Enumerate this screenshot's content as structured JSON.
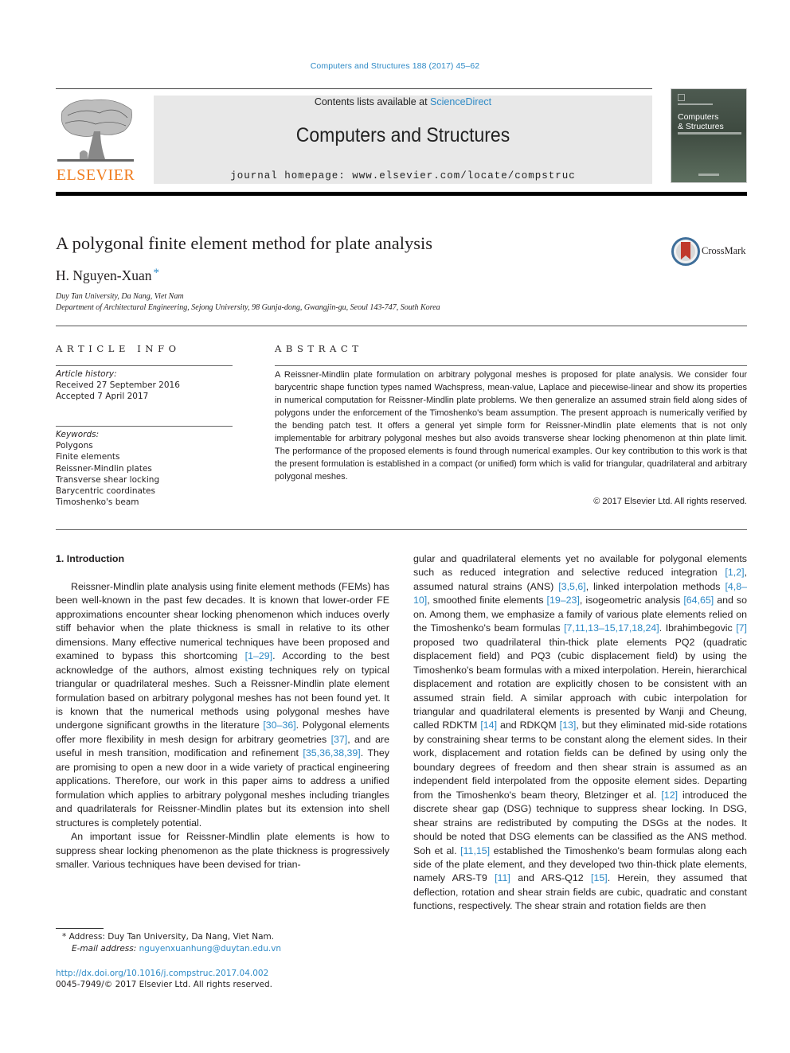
{
  "running_head": "Computers and Structures 188 (2017) 45–62",
  "masthead": {
    "publisher_logo_text": "ELSEVIER",
    "contents_prefix": "Contents lists available at ",
    "contents_link": "ScienceDirect",
    "journal_name": "Computers and Structures",
    "homepage": "journal homepage: www.elsevier.com/locate/compstruc",
    "cover_title_line1": "Computers",
    "cover_title_line2": "& Structures"
  },
  "colors": {
    "link": "#2e8ac6",
    "elsevier_orange": "#f07c1d",
    "masthead_gray": "#e8e8e8"
  },
  "article": {
    "title": "A polygonal finite element method for plate analysis",
    "crossmark_label": "CrossMark",
    "author": "H. Nguyen-Xuan",
    "author_mark": "*",
    "affiliations": [
      "Duy Tan University, Da Nang, Viet Nam",
      "Department of Architectural Engineering, Sejong University, 98 Gunja-dong, Gwangjin-gu, Seoul 143-747, South Korea"
    ]
  },
  "article_info": {
    "heading": "ARTICLE INFO",
    "history_label": "Article history:",
    "received": "Received 27 September 2016",
    "accepted": "Accepted 7 April 2017",
    "keywords_label": "Keywords:",
    "keywords": [
      "Polygons",
      "Finite elements",
      "Reissner-Mindlin plates",
      "Transverse shear locking",
      "Barycentric coordinates",
      "Timoshenko's beam"
    ]
  },
  "abstract": {
    "heading": "ABSTRACT",
    "text": "A Reissner-Mindlin plate formulation on arbitrary polygonal meshes is proposed for plate analysis. We consider four barycentric shape function types named Wachspress, mean-value, Laplace and piecewise-linear and show its properties in numerical computation for Reissner-Mindlin plate problems. We then generalize an assumed strain field along sides of polygons under the enforcement of the Timoshenko's beam assumption. The present approach is numerically verified by the bending patch test. It offers a general yet simple form for Reissner-Mindlin plate elements that is not only implementable for arbitrary polygonal meshes but also avoids transverse shear locking phenomenon at thin plate limit. The performance of the proposed elements is found through numerical examples. Our key contribution to this work is that the present formulation is established in a compact (or unified) form which is valid for triangular, quadrilateral and arbitrary polygonal meshes.",
    "copyright": "© 2017 Elsevier Ltd. All rights reserved."
  },
  "body": {
    "section_heading": "1. Introduction",
    "left": {
      "p1": [
        {
          "t": "Reissner-Mindlin plate analysis using finite element methods (FEMs) has been well-known in the past few decades. It is known that lower-order FE approximations encounter shear locking phenomenon which induces overly stiff behavior when the plate thickness is small in relative to its other dimensions. Many effective numerical techniques have been proposed and examined to bypass this shortcoming "
        },
        {
          "ref": "[1–29]"
        },
        {
          "t": ". According to the best acknowledge of the authors, almost existing techniques rely on typical triangular or quadrilateral meshes. Such a Reissner-Mindlin plate element formulation based on arbitrary polygonal meshes has not been found yet. It is known that the numerical methods using polygonal meshes have undergone significant growths in the literature "
        },
        {
          "ref": "[30–36]"
        },
        {
          "t": ". Polygonal elements offer more flexibility in mesh design for arbitrary geometries "
        },
        {
          "ref": "[37]"
        },
        {
          "t": ", and are useful in mesh transition, modification and refinement "
        },
        {
          "ref": "[35,36,38,39]"
        },
        {
          "t": ". They are promising to open a new door in a wide variety of practical engineering applications. Therefore, our work in this paper aims to address a unified formulation which applies to arbitrary polygonal meshes including triangles and quadrilaterals for Reissner-Mindlin plates but its extension into shell structures is completely potential."
        }
      ],
      "p2": [
        {
          "t": "An important issue for Reissner-Mindlin plate elements is how to suppress shear locking phenomenon as the plate thickness is progressively smaller. Various techniques have been devised for trian-"
        }
      ]
    },
    "right": {
      "p1": [
        {
          "t": "gular and quadrilateral elements yet no available for polygonal elements such as reduced integration and selective reduced integration "
        },
        {
          "ref": "[1,2]"
        },
        {
          "t": ", assumed natural strains (ANS) "
        },
        {
          "ref": "[3,5,6]"
        },
        {
          "t": ", linked interpolation methods "
        },
        {
          "ref": "[4,8–10]"
        },
        {
          "t": ", smoothed finite elements "
        },
        {
          "ref": "[19–23]"
        },
        {
          "t": ", isogeometric analysis "
        },
        {
          "ref": "[64,65]"
        },
        {
          "t": " and so on. Among them, we emphasize a family of various plate elements relied on the Timoshenko's beam formulas "
        },
        {
          "ref": "[7,11,13–15,17,18,24]"
        },
        {
          "t": ". Ibrahimbegovic "
        },
        {
          "ref": "[7]"
        },
        {
          "t": " proposed two quadrilateral thin-thick plate elements PQ2 (quadratic displacement field) and PQ3 (cubic displacement field) by using the Timoshenko's beam formulas with a mixed interpolation. Herein, hierarchical displacement and rotation are explicitly chosen to be consistent with an assumed strain field. A similar approach with cubic interpolation for triangular and quadrilateral elements is presented by Wanji and Cheung, called RDKTM "
        },
        {
          "ref": "[14]"
        },
        {
          "t": " and RDKQM "
        },
        {
          "ref": "[13]"
        },
        {
          "t": ", but they eliminated mid-side rotations by constraining shear terms to be constant along the element sides. In their work, displacement and rotation fields can be defined by using only the boundary degrees of freedom and then shear strain is assumed as an independent field interpolated from the opposite element sides. Departing from the Timoshenko's beam theory, Bletzinger et al. "
        },
        {
          "ref": "[12]"
        },
        {
          "t": " introduced the discrete shear gap (DSG) technique to suppress shear locking. In DSG, shear strains are redistributed by computing the DSGs at the nodes. It should be noted that DSG elements can be classified as the ANS method. Soh et al. "
        },
        {
          "ref": "[11,15]"
        },
        {
          "t": " established the Timoshenko's beam formulas along each side of the plate element, and they developed two thin-thick plate elements, namely ARS-T9 "
        },
        {
          "ref": "[11]"
        },
        {
          "t": " and ARS-Q12 "
        },
        {
          "ref": "[15]"
        },
        {
          "t": ". Herein, they assumed that deflection, rotation and shear strain fields are cubic, quadratic and constant functions, respectively. The shear strain and rotation fields are then"
        }
      ]
    }
  },
  "footnotes": {
    "mark": "*",
    "address": "Address: Duy Tan University, Da Nang, Viet Nam.",
    "email_label": "E-mail address: ",
    "email": "nguyenxuanhung@duytan.edu.vn",
    "doi": "http://dx.doi.org/10.1016/j.compstruc.2017.04.002",
    "issn_copyright": "0045-7949/© 2017 Elsevier Ltd. All rights reserved."
  }
}
